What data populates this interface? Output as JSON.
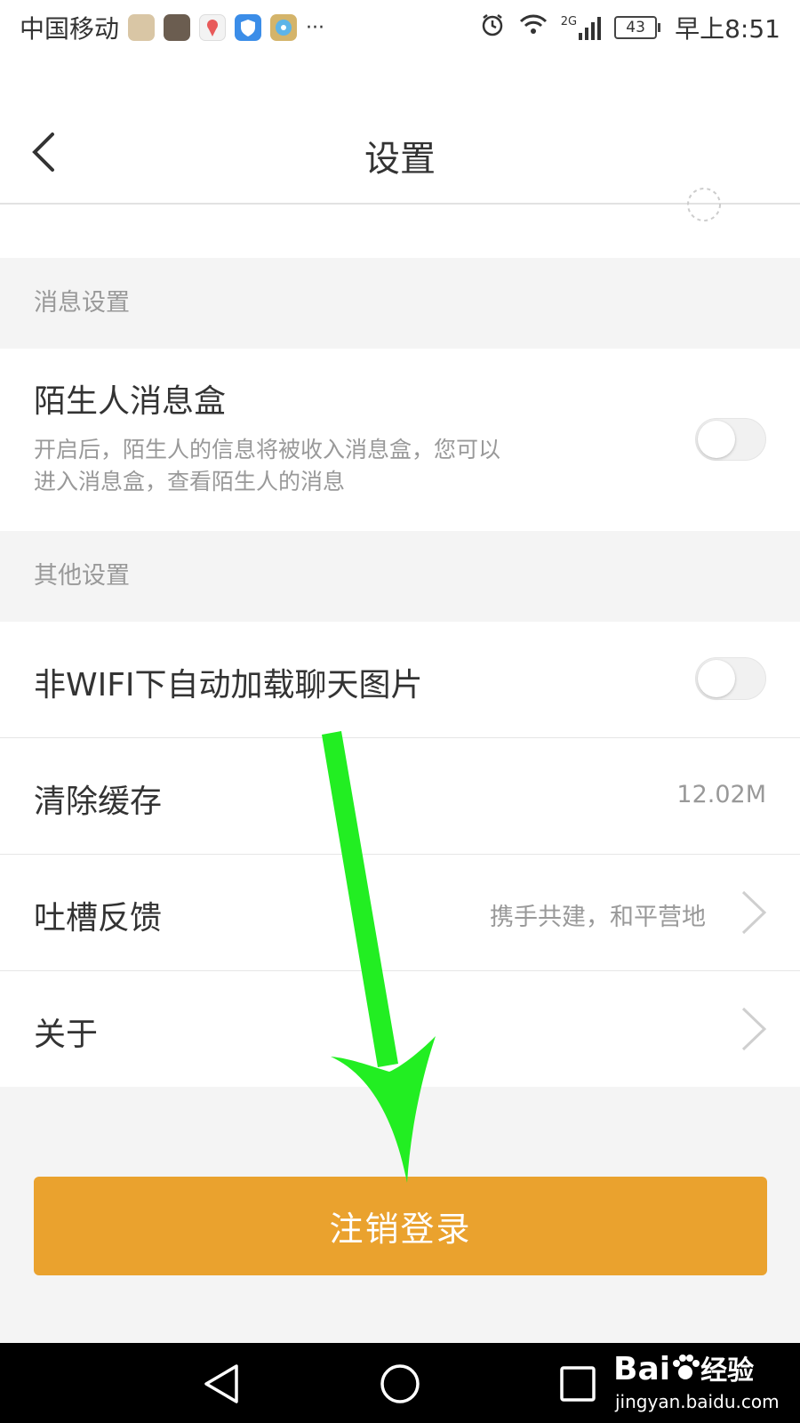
{
  "status_bar": {
    "carrier": "中国移动",
    "overflow": "···",
    "network": "2G",
    "battery": "43",
    "time": "早上8:51"
  },
  "header": {
    "title": "设置"
  },
  "sections": {
    "message": {
      "header": "消息设置",
      "stranger_box": {
        "title": "陌生人消息盒",
        "desc_line1": "开启后，陌生人的信息将被收入消息盒，您可以",
        "desc_line2": "进入消息盒，查看陌生人的消息",
        "enabled": false
      }
    },
    "other": {
      "header": "其他设置",
      "wifi_images": {
        "title": "非WIFI下自动加载聊天图片",
        "enabled": false
      },
      "clear_cache": {
        "title": "清除缓存",
        "value": "12.02M"
      },
      "feedback": {
        "title": "吐槽反馈",
        "value": "携手共建，和平营地"
      },
      "about": {
        "title": "关于"
      }
    }
  },
  "logout": {
    "label": "注销登录"
  },
  "watermark": {
    "logo": "Bai",
    "logo_cn": "经验",
    "url": "jingyan.baidu.com"
  },
  "colors": {
    "accent": "#eaa22e",
    "arrow": "#22ee22",
    "background": "#f4f4f4"
  }
}
